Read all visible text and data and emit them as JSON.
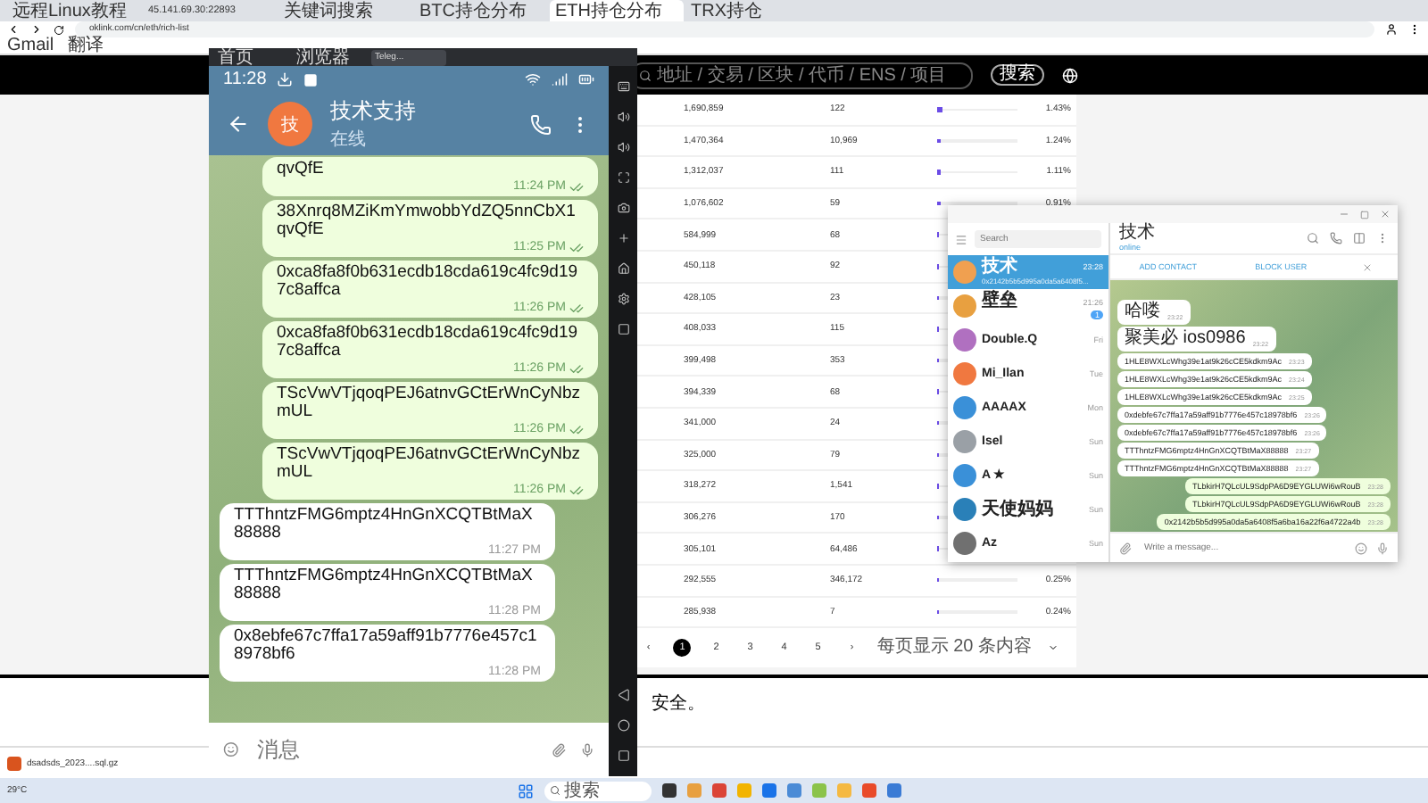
{
  "browser": {
    "tabs": [
      {
        "label": "远程Linux教程",
        "selected": false
      },
      {
        "label": "45.141.69.30:22893",
        "selected": false
      },
      {
        "label": "关键词搜索",
        "selected": false
      },
      {
        "label": "BTC持仓分布",
        "selected": false
      },
      {
        "label": "ETH持仓分布",
        "selected": true
      },
      {
        "label": "TRX持仓",
        "selected": false
      }
    ],
    "address": "oklink.com/cn/eth/rich-list",
    "bookmarks": [
      "Gmail",
      "翻译"
    ]
  },
  "page": {
    "search": {
      "placeholder": "地址 / 交易 / 区块 / 代币 / ENS / 项目"
    },
    "search_button": "搜索",
    "rows": [
      {
        "balance": "1,690,859",
        "txs": "122",
        "level": 0.06,
        "pct": "1.43%"
      },
      {
        "balance": "1,470,364",
        "txs": "10,969",
        "level": 0.05,
        "pct": "1.24%"
      },
      {
        "balance": "1,312,037",
        "txs": "111",
        "level": 0.05,
        "pct": "1.11%"
      },
      {
        "balance": "1,076,602",
        "txs": "59",
        "level": 0.04,
        "pct": "0.91%"
      },
      {
        "balance": "584,999",
        "txs": "68",
        "level": 0.03
      },
      {
        "balance": "450,118",
        "txs": "92",
        "level": 0.03
      },
      {
        "balance": "428,105",
        "txs": "23",
        "level": 0.03
      },
      {
        "balance": "408,033",
        "txs": "115",
        "level": 0.03
      },
      {
        "balance": "399,498",
        "txs": "353",
        "level": 0.03
      },
      {
        "balance": "394,339",
        "txs": "68",
        "level": 0.03
      },
      {
        "balance": "341,000",
        "txs": "24",
        "level": 0.02
      },
      {
        "balance": "325,000",
        "txs": "79",
        "level": 0.02
      },
      {
        "balance": "318,272",
        "txs": "1,541",
        "level": 0.02
      },
      {
        "balance": "306,276",
        "txs": "170",
        "level": 0.02
      },
      {
        "balance": "305,101",
        "txs": "64,486",
        "level": 0.02
      },
      {
        "balance": "292,555",
        "txs": "346,172",
        "level": 0.02,
        "pct": "0.25%"
      },
      {
        "balance": "285,938",
        "txs": "7",
        "level": 0.02,
        "pct": "0.24%"
      }
    ],
    "pagination": {
      "prev": "‹",
      "pages": [
        {
          "label": "1",
          "selected": true
        },
        {
          "label": "2",
          "selected": false
        },
        {
          "label": "3",
          "selected": false
        },
        {
          "label": "4",
          "selected": false
        },
        {
          "label": "5",
          "selected": false
        }
      ],
      "next": "›",
      "page_size": "每页显示 20 条内容"
    },
    "footer_text": "安全。"
  },
  "download": {
    "file": "dsadsds_2023....sql.gz"
  },
  "taskbar": {
    "weather": "29°C",
    "search": "搜索"
  },
  "emulator": {
    "tabs": [
      {
        "label": "首页",
        "selected": false
      },
      {
        "label": "浏览器",
        "selected": false
      },
      {
        "label": "Teleg...",
        "selected": true
      }
    ],
    "time": "11:28",
    "avatar": "技",
    "title": "技术支持",
    "status": "在线",
    "messages": [
      {
        "kind": "out",
        "text": "qvQfE",
        "time": "11:24 PM"
      },
      {
        "kind": "out",
        "text": "38Xnrq8MZiKmYmwobbYdZQ5nnCbX1qvQfE",
        "time": "11:25 PM"
      },
      {
        "kind": "out",
        "text": "0xca8fa8f0b631ecdb18cda619c4fc9d197c8affca",
        "time": "11:26 PM"
      },
      {
        "kind": "out",
        "text": "0xca8fa8f0b631ecdb18cda619c4fc9d197c8affca",
        "time": "11:26 PM"
      },
      {
        "kind": "out",
        "text": "TScVwVTjqoqPEJ6atnvGCtErWnCyNbzmUL",
        "time": "11:26 PM"
      },
      {
        "kind": "out",
        "text": "TScVwVTjqoqPEJ6atnvGCtErWnCyNbzmUL",
        "time": "11:26 PM"
      },
      {
        "kind": "in",
        "text": "TTThntzFMG6mptz4HnGnXCQTBtMaX88888",
        "time": "11:27 PM"
      },
      {
        "kind": "in",
        "text": "TTThntzFMG6mptz4HnGnXCQTBtMaX88888",
        "time": "11:28 PM"
      },
      {
        "kind": "in",
        "text": "0x8ebfe67c7ffa17a59aff91b7776e457c18978bf6",
        "time": "11:28 PM"
      }
    ],
    "input": {
      "placeholder": "消息"
    }
  },
  "telegram": {
    "search": {
      "placeholder": "Search"
    },
    "chats": [
      {
        "name": "技术",
        "preview": "0x2142b5b5d995a0da5a6408f5...",
        "time": "23:28",
        "selected": true,
        "color": "#f0a050"
      },
      {
        "name": "壁垒",
        "time": "21:26",
        "badge": "1",
        "selected": false,
        "color": "#e8a040"
      },
      {
        "name": "Double.Q",
        "time": "Fri",
        "selected": false,
        "color": "#b070c0"
      },
      {
        "name": "Mi_Ilan",
        "time": "Tue",
        "selected": false,
        "color": "#f07840"
      },
      {
        "name": "AAAAX",
        "time": "Mon",
        "selected": false,
        "color": "#3a90d8"
      },
      {
        "name": "Isel",
        "time": "Sun",
        "selected": false,
        "color": "#9aa0a6"
      },
      {
        "name": "A ★",
        "time": "Sun",
        "selected": false,
        "color": "#3a90d8"
      },
      {
        "name": "天使妈妈",
        "time": "Sun",
        "selected": false,
        "color": "#2a80b8"
      },
      {
        "name": "Az",
        "time": "Sun",
        "selected": false,
        "color": "#707070"
      }
    ],
    "header": {
      "name": "技术",
      "status": "online"
    },
    "actions": [
      "ADD CONTACT",
      "BLOCK USER"
    ],
    "messages": [
      {
        "kind": "in",
        "text": "哈喽",
        "time": "23:22"
      },
      {
        "kind": "in",
        "text": "聚美必 ios0986",
        "time": "23:22"
      },
      {
        "kind": "in",
        "text": "1HLE8WXLcWhg39e1at9k26cCE5kdkm9Ac",
        "time": "23:23"
      },
      {
        "kind": "in",
        "text": "1HLE8WXLcWhg39e1at9k26cCE5kdkm9Ac",
        "time": "23:24"
      },
      {
        "kind": "in",
        "text": "1HLE8WXLcWhg39e1at9k26cCE5kdkm9Ac",
        "time": "23:25"
      },
      {
        "kind": "in",
        "text": "0xdebfe67c7ffa17a59aff91b7776e457c18978bf6",
        "time": "23:26"
      },
      {
        "kind": "in",
        "text": "0xdebfe67c7ffa17a59aff91b7776e457c18978bf6",
        "time": "23:26"
      },
      {
        "kind": "in",
        "text": "TTThntzFMG6mptz4HnGnXCQTBtMaX88888",
        "time": "23:27"
      },
      {
        "kind": "in",
        "text": "TTThntzFMG6mptz4HnGnXCQTBtMaX88888",
        "time": "23:27"
      },
      {
        "kind": "out",
        "text": "TLbkirH7QLcUL9SdpPA6D9EYGLUWi6wRouB",
        "time": "23:28"
      },
      {
        "kind": "out",
        "text": "TLbkirH7QLcUL9SdpPA6D9EYGLUWi6wRouB",
        "time": "23:28"
      },
      {
        "kind": "out",
        "text": "0x2142b5b5d995a0da5a6408f5a6ba16a22f6a4722a4b",
        "time": "23:28"
      }
    ],
    "input": {
      "placeholder": "Write a message..."
    }
  }
}
